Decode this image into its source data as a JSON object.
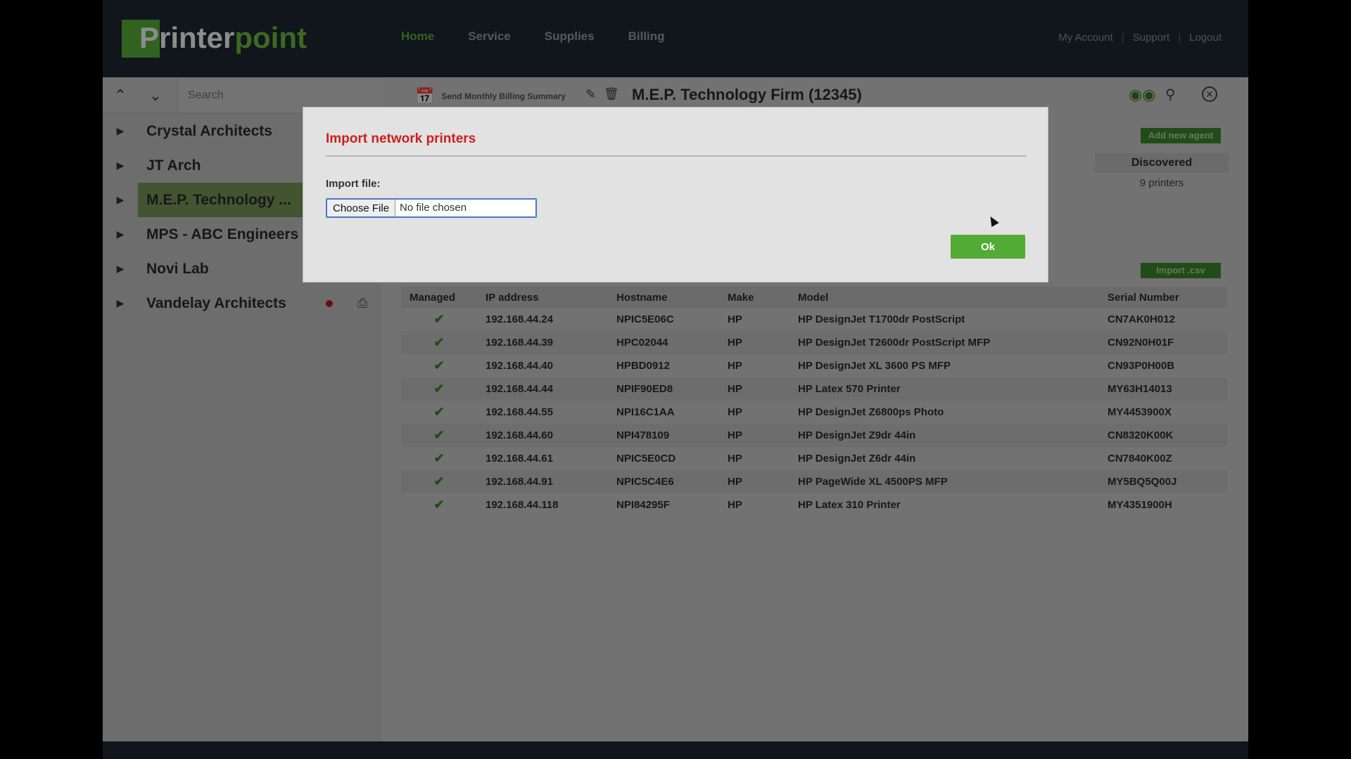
{
  "app": {
    "logo_part1": "Printer",
    "logo_part2": "point"
  },
  "nav": {
    "items": [
      {
        "label": "Home",
        "active": true
      },
      {
        "label": "Service"
      },
      {
        "label": "Supplies"
      },
      {
        "label": "Billing"
      }
    ],
    "user_links": [
      "My Account",
      "Support",
      "Logout"
    ]
  },
  "sidebar": {
    "search_placeholder": "Search",
    "customers": [
      {
        "name": "Crystal Architects"
      },
      {
        "name": "JT Arch"
      },
      {
        "name": "M.E.P. Technology ...",
        "selected": true
      },
      {
        "name": "MPS - ABC Engineers"
      },
      {
        "name": "Novi Lab"
      },
      {
        "name": "Vandelay Architects",
        "alert": true
      }
    ]
  },
  "content": {
    "billing_summary_label": "Send Monthly Billing Summary",
    "title": "M.E.P. Technology Firm (12345)",
    "add_agent_label": "Add new agent",
    "discovered_header": "Discovered",
    "discovered_value": "9 printers",
    "import_csv_label": "Import .csv"
  },
  "table": {
    "columns": [
      "Managed",
      "IP address",
      "Hostname",
      "Make",
      "Model",
      "Serial Number"
    ],
    "rows": [
      {
        "managed": "✔",
        "ip": "192.168.44.24",
        "host": "NPIC5E06C",
        "make": "HP",
        "model": "HP DesignJet T1700dr PostScript",
        "serial": "CN7AK0H012"
      },
      {
        "managed": "✔",
        "ip": "192.168.44.39",
        "host": "HPC02044",
        "make": "HP",
        "model": "HP DesignJet T2600dr PostScript MFP",
        "serial": "CN92N0H01F"
      },
      {
        "managed": "✔",
        "ip": "192.168.44.40",
        "host": "HPBD0912",
        "make": "HP",
        "model": "HP DesignJet XL 3600 PS MFP",
        "serial": "CN93P0H00B"
      },
      {
        "managed": "✔",
        "ip": "192.168.44.44",
        "host": "NPIF90ED8",
        "make": "HP",
        "model": "HP Latex 570 Printer",
        "serial": "MY63H14013"
      },
      {
        "managed": "✔",
        "ip": "192.168.44.55",
        "host": "NPI16C1AA",
        "make": "HP",
        "model": "HP DesignJet Z6800ps Photo",
        "serial": "MY4453900X"
      },
      {
        "managed": "✔",
        "ip": "192.168.44.60",
        "host": "NPI478109",
        "make": "HP",
        "model": "HP DesignJet Z9dr 44in",
        "serial": "CN8320K00K"
      },
      {
        "managed": "✔",
        "ip": "192.168.44.61",
        "host": "NPIC5E0CD",
        "make": "HP",
        "model": "HP DesignJet Z6dr 44in",
        "serial": "CN7840K00Z"
      },
      {
        "managed": "✔",
        "ip": "192.168.44.91",
        "host": "NPIC5C4E6",
        "make": "HP",
        "model": "HP PageWide XL 4500PS MFP",
        "serial": "MY5BQ5Q00J"
      },
      {
        "managed": "✔",
        "ip": "192.168.44.118",
        "host": "NPI84295F",
        "make": "HP",
        "model": "HP Latex 310 Printer",
        "serial": "MY4351900H"
      }
    ]
  },
  "modal": {
    "title": "Import network printers",
    "import_label": "Import file:",
    "choose_file_label": "Choose File",
    "no_file_text": "No file chosen",
    "ok_label": "Ok"
  },
  "colors": {
    "brand_green": "#5bb23a",
    "modal_title_red": "#cc1f1f",
    "topbar": "#1e2833"
  }
}
